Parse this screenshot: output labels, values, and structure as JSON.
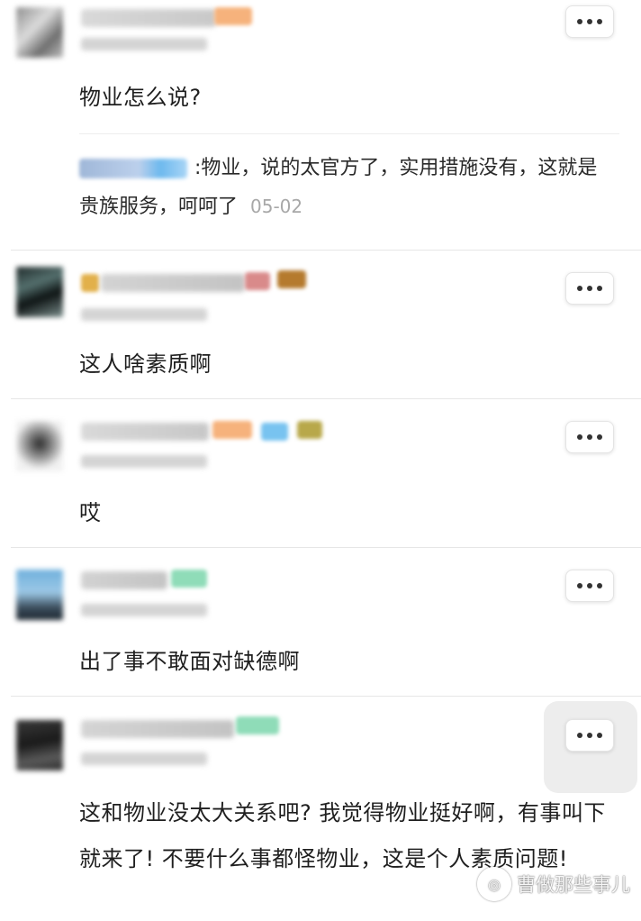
{
  "comments": [
    {
      "text": "物业怎么说?",
      "reply": {
        "text": ":物业，说的太官方了，实用措施没有，这就是贵族服务，呵呵了",
        "date": "05-02"
      }
    },
    {
      "text": "这人啥素质啊"
    },
    {
      "text": "哎"
    },
    {
      "text": "出了事不敢面对缺德啊"
    },
    {
      "text": "这和物业没太大关系吧? 我觉得物业挺好啊，有事叫下就来了! 不要什么事都怪物业，这是个人素质问题!"
    }
  ],
  "more_button": {
    "icon": "more-dots-icon"
  },
  "watermark": {
    "text": "曹做那些事儿"
  },
  "colors": {
    "divider": "#e6e6e6",
    "date_gray": "#a8a8a8",
    "badge_orange": "#f6b27c",
    "badge_blue": "#78c3f0",
    "badge_green": "#8fdcb8"
  }
}
